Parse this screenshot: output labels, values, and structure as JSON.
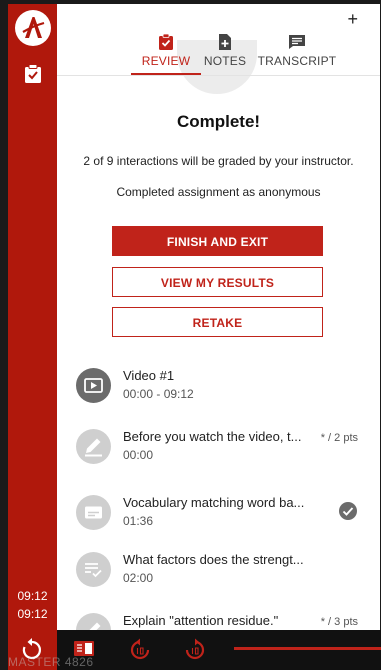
{
  "rail": {
    "times": [
      "09:12",
      "09:12"
    ]
  },
  "tabs": [
    {
      "label": "REVIEW",
      "active": true
    },
    {
      "label": "NOTES",
      "active": false
    },
    {
      "label": "TRANSCRIPT",
      "active": false
    }
  ],
  "header": {
    "plus_label": "+"
  },
  "summary": {
    "title": "Complete!",
    "graded_text": "2 of 9 interactions will be graded by your instructor.",
    "anonymous_text": "Completed assignment as anonymous"
  },
  "actions": {
    "finish_label": "FINISH AND EXIT",
    "results_label": "VIEW MY RESULTS",
    "retake_label": "RETAKE"
  },
  "items": [
    {
      "title": "Video #1",
      "time": "00:00 - 09:12",
      "icon": "video-icon",
      "pts": ""
    },
    {
      "title": "Before you watch the video, t...",
      "time": "00:00",
      "icon": "pencil-icon",
      "pts": "* / 2 pts"
    },
    {
      "title": "Vocabulary matching word ba...",
      "time": "01:36",
      "icon": "matching-icon",
      "pts": ""
    },
    {
      "title": "What factors does the strengt...",
      "time": "02:00",
      "icon": "checklist-icon",
      "pts": ""
    },
    {
      "title": "Explain \"attention residue.\"",
      "time": "",
      "icon": "pencil-icon",
      "pts": "* / 3 pts"
    }
  ],
  "watermark": "MASTER 4826",
  "colors": {
    "brand": "#c0231a",
    "rail": "#b0180c",
    "icon_gray": "#6b6b6b"
  }
}
